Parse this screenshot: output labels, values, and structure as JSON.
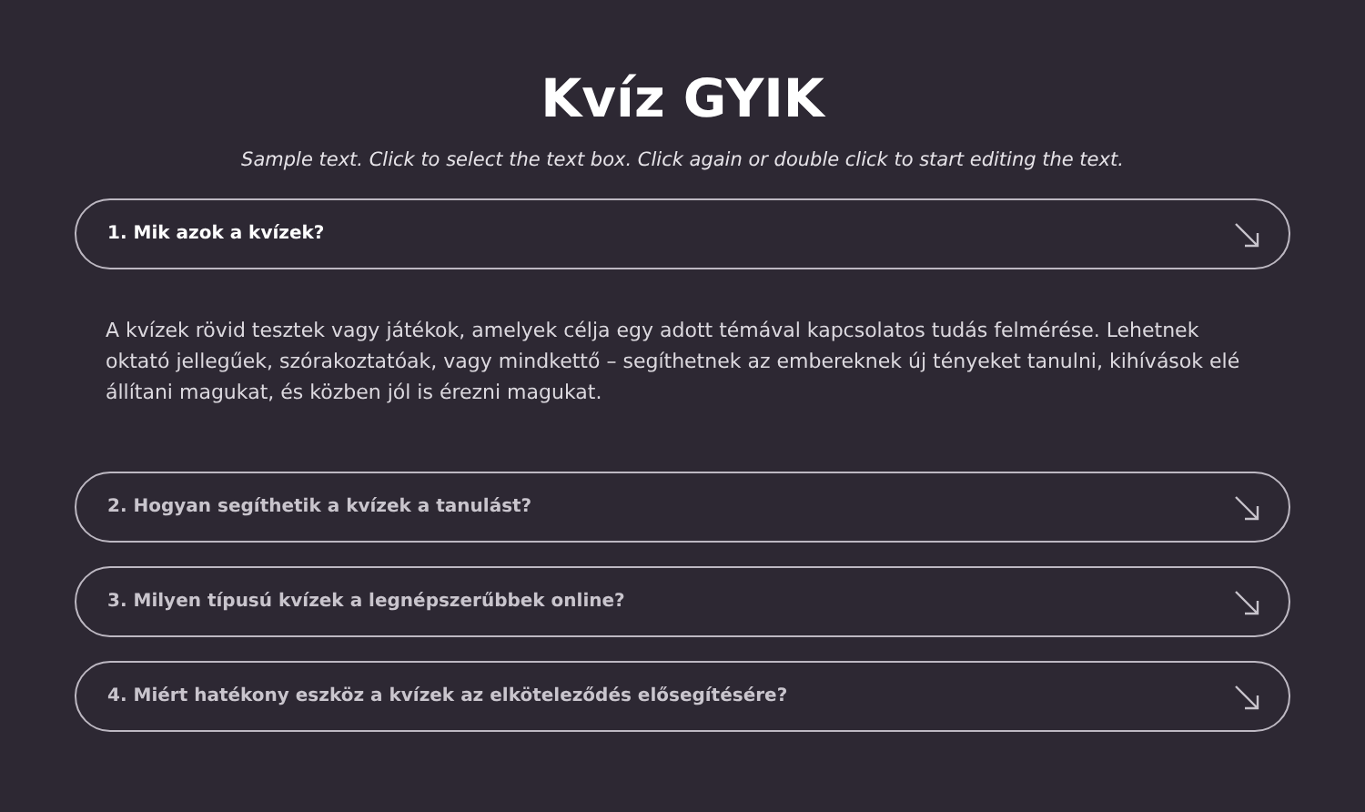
{
  "title": "Kvíz GYIK",
  "subtitle": "Sample text. Click to select the text box. Click again or double click to start editing the text.",
  "faq": [
    {
      "question": "1. Mik azok a kvízek?",
      "expanded": true,
      "answer": "A kvízek rövid tesztek vagy játékok, amelyek célja egy adott témával kapcsolatos tudás felmérése. Lehetnek oktató jellegűek, szórakoztatóak, vagy mindkettő – segíthetnek az embereknek új tényeket tanulni, kihívások elé állítani magukat, és közben jól is érezni magukat."
    },
    {
      "question": "2. Hogyan segíthetik a kvízek a tanulást?",
      "expanded": false
    },
    {
      "question": "3. Milyen típusú kvízek a legnépszerűbbek online?",
      "expanded": false
    },
    {
      "question": "4. Miért hatékony eszköz a kvízek az elköteleződés elősegítésére?",
      "expanded": false
    }
  ]
}
